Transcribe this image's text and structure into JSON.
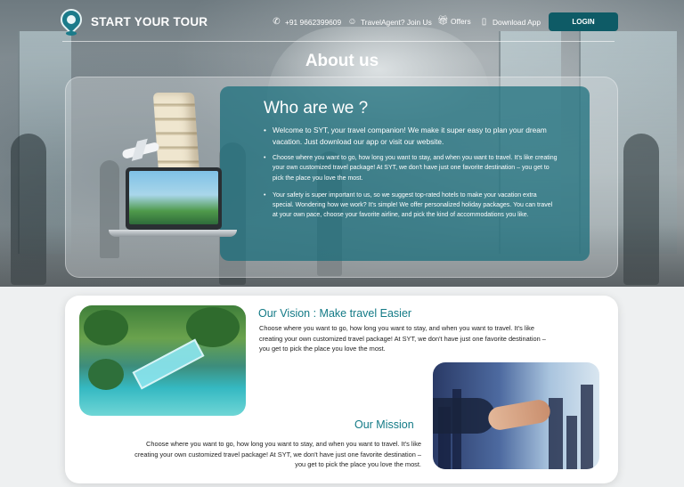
{
  "header": {
    "brand": "START YOUR TOUR",
    "phone": "+91 9662399609",
    "agent_link": "TravelAgent? Join Us",
    "offers_link": "Offers",
    "download_link": "Download App",
    "login_button": "LOGIN",
    "icons": [
      "map-pin-logo",
      "phone-icon",
      "agent-icon",
      "gift-icon",
      "mobile-icon"
    ]
  },
  "hero": {
    "title": "About us",
    "who_title": "Who are we ?",
    "points": [
      "Welcome to SYT, your travel companion! We make it super easy to plan your dream vacation. Just download our app or visit our website.",
      "Choose where you want to go, how long you want to stay, and when you want to travel. It's like creating your own customized travel package! At SYT, we don't have just one favorite destination – you get to pick the place you love the most.",
      "Your safety is super important to us, so we suggest top-rated hotels to make your vacation extra special. Wondering how we work? It's simple! We offer personalized holiday packages. You can travel at your own pace, choose your favorite airline, and pick the kind of accommodations you like."
    ]
  },
  "vision": {
    "title": "Our Vision : Make travel Easier",
    "text": "Choose where you want to go, how long you want to stay, and when you want to travel. It's like creating your own customized travel package! At SYT, we don't have just one favorite destination – you get to pick the place you love the most."
  },
  "mission": {
    "title": "Our Mission",
    "text": "Choose where you want to go, how long you want to stay, and when you want to travel. It's like creating your own customized travel package! At SYT, we don't have just one favorite destination – you get to pick the place you love the most."
  },
  "colors": {
    "accent": "#137a86",
    "login_bg": "#0e5b66",
    "who_panel": "#166c7a"
  }
}
